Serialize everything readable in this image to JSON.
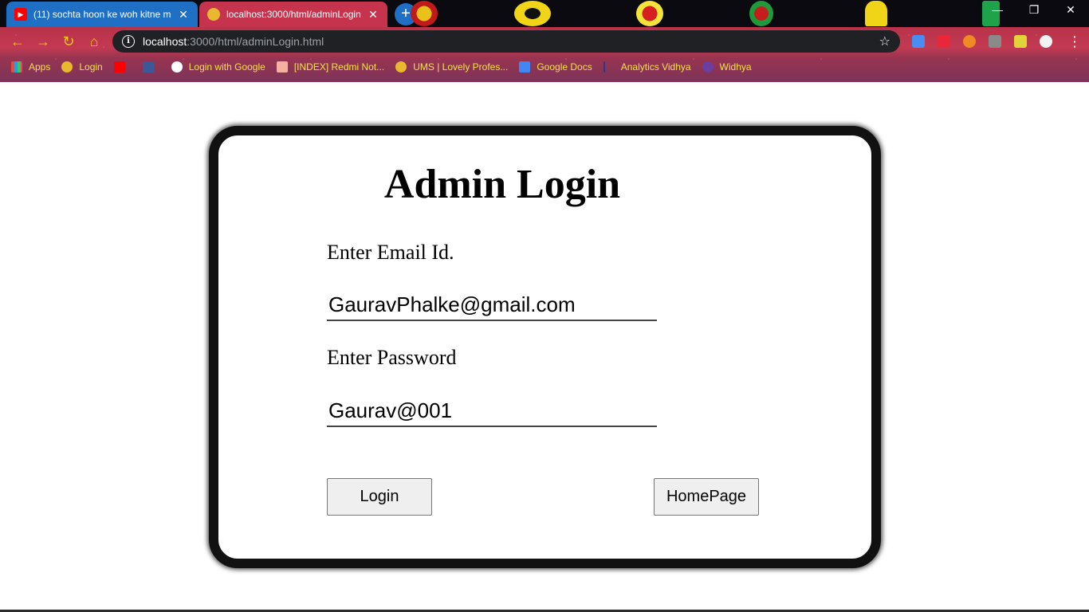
{
  "browser": {
    "tabs": [
      {
        "title": "(11) sochta hoon ke woh kitne m",
        "icon": "youtube-icon",
        "active": false
      },
      {
        "title": "localhost:3000/html/adminLogin",
        "icon": "globe-icon",
        "active": true
      }
    ],
    "new_tab_label": "+",
    "window_controls": {
      "minimize": "—",
      "restore": "❐",
      "close": "✕"
    },
    "nav": {
      "back": "←",
      "forward": "→",
      "reload": "↻",
      "home": "⌂"
    },
    "address": {
      "host": "localhost",
      "path": ":3000/html/adminLogin.html",
      "info": "i",
      "star": "☆"
    },
    "bookmarks": [
      {
        "label": "Apps",
        "icon": "apps-grid-icon"
      },
      {
        "label": "Login",
        "icon": "globe-icon"
      },
      {
        "label": "",
        "icon": "youtube-icon"
      },
      {
        "label": "",
        "icon": "facebook-icon"
      },
      {
        "label": "Login with Google",
        "icon": "google-icon"
      },
      {
        "label": "[INDEX] Redmi Not...",
        "icon": "xda-icon"
      },
      {
        "label": "UMS | Lovely Profes...",
        "icon": "globe-icon"
      },
      {
        "label": "Google Docs",
        "icon": "docs-icon"
      },
      {
        "label": "Analytics Vidhya",
        "icon": "analytics-vidhya-icon"
      },
      {
        "label": "Widhya",
        "icon": "widhya-icon"
      }
    ],
    "colors": {
      "active_tab": "#c6334d",
      "inactive_tab": "#1f6fc4",
      "accent": "#f0c419"
    }
  },
  "page": {
    "title": "Admin Login",
    "email": {
      "label": "Enter Email Id.",
      "value": "GauravPhalke@gmail.com"
    },
    "password": {
      "label": "Enter Password",
      "value": "Gaurav@001"
    },
    "login_button": "Login",
    "homepage_button": "HomePage"
  }
}
